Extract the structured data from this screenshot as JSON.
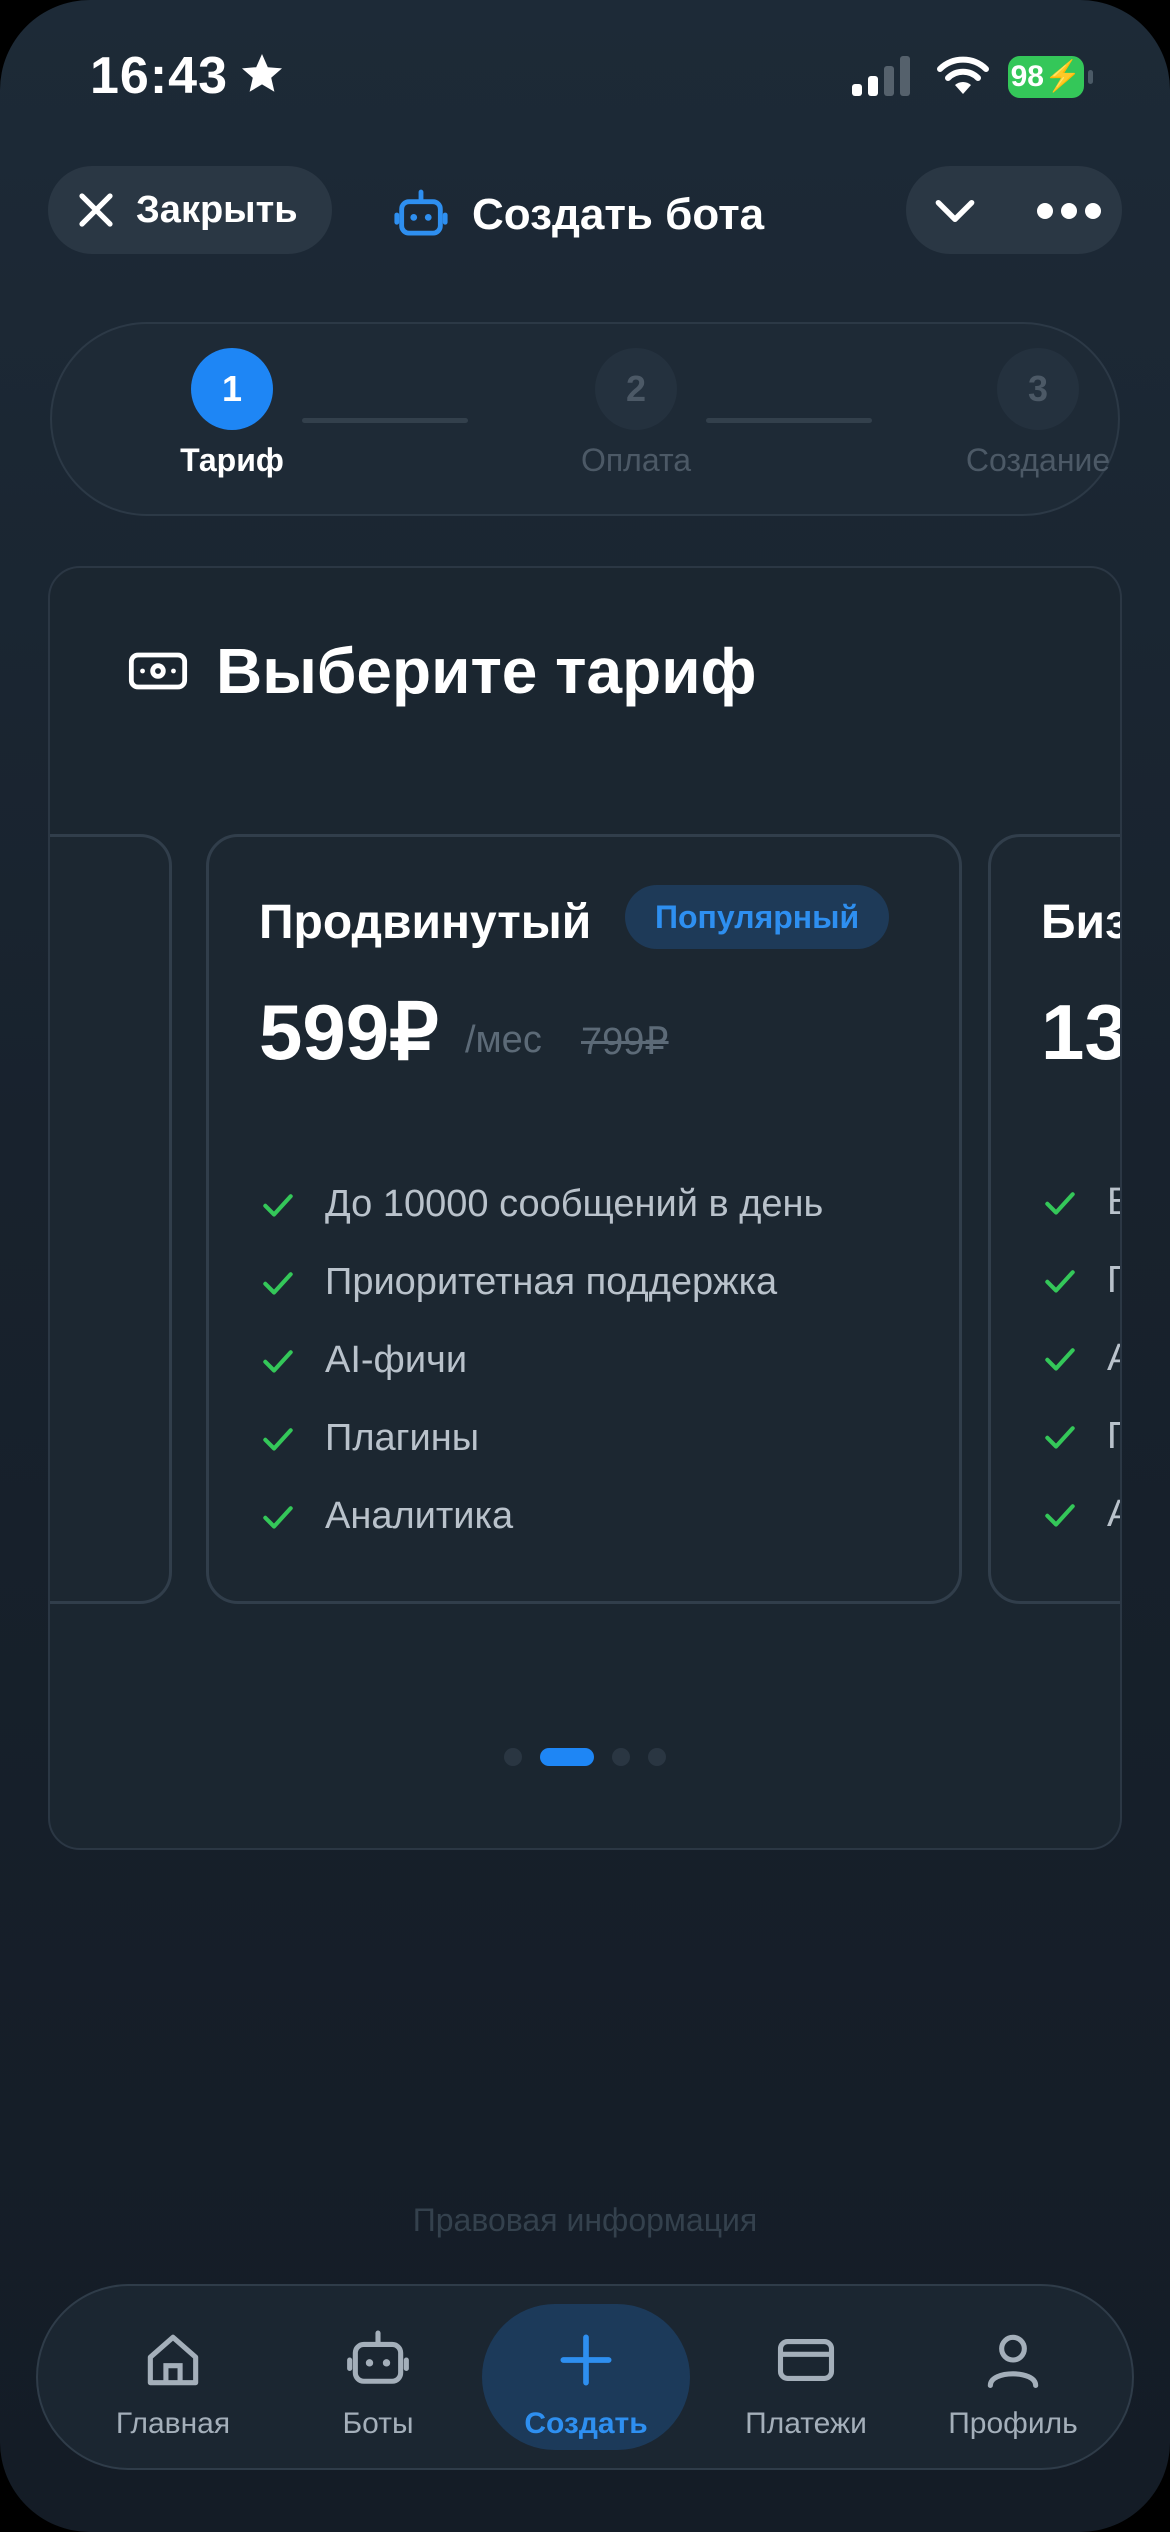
{
  "status_bar": {
    "time": "16:43",
    "battery": "98"
  },
  "header": {
    "close_label": "Закрыть",
    "title": "Создать бота"
  },
  "stepper": {
    "steps": [
      {
        "number": "1",
        "label": "Тариф"
      },
      {
        "number": "2",
        "label": "Оплата"
      },
      {
        "number": "3",
        "label": "Создание"
      }
    ],
    "active_index": 0
  },
  "tariff_card": {
    "title": "Выберите тариф",
    "plans": [
      {
        "name": "Продвинутый",
        "badge": "Популярный",
        "price": "599₽",
        "period": "/мес",
        "old_price": "799₽",
        "features": [
          "До 10000 сообщений в день",
          "Приоритетная поддержка",
          "AI-фичи",
          "Плагины",
          "Аналитика"
        ]
      },
      {
        "name": "Биз",
        "price": "13",
        "features": [
          "Б",
          "П",
          "А",
          "П",
          "А"
        ]
      }
    ],
    "pagination": {
      "count": 4,
      "active": 1
    }
  },
  "legal_link": "Правовая информация",
  "tabbar": {
    "items": [
      {
        "label": "Главная",
        "icon": "home-icon"
      },
      {
        "label": "Боты",
        "icon": "bot-icon"
      },
      {
        "label": "Создать",
        "icon": "plus-icon"
      },
      {
        "label": "Платежи",
        "icon": "card-icon"
      },
      {
        "label": "Профиль",
        "icon": "person-icon"
      }
    ],
    "active_index": 2
  },
  "colors": {
    "accent": "#1e86f5",
    "check": "#34c759",
    "background": "#18222d"
  }
}
